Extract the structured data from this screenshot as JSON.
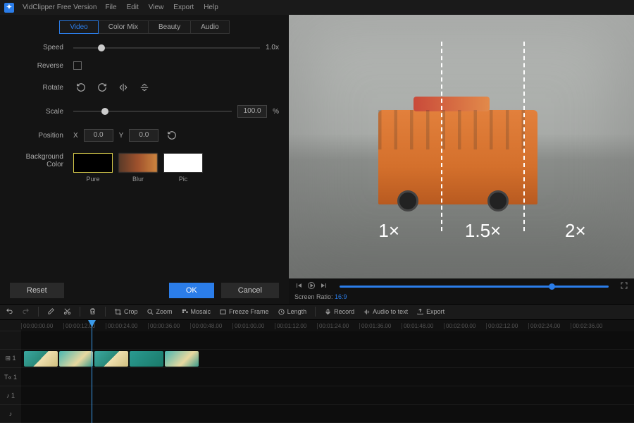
{
  "app": {
    "title": "VidClipper Free Version"
  },
  "menu": [
    "File",
    "Edit",
    "View",
    "Export",
    "Help"
  ],
  "tabs": [
    {
      "label": "Video",
      "active": true
    },
    {
      "label": "Color Mix",
      "active": false
    },
    {
      "label": "Beauty",
      "active": false
    },
    {
      "label": "Audio",
      "active": false
    }
  ],
  "form": {
    "speed": {
      "label": "Speed",
      "value": "1.0x",
      "pos": 15
    },
    "reverse": {
      "label": "Reverse",
      "checked": false
    },
    "rotate": {
      "label": "Rotate"
    },
    "scale": {
      "label": "Scale",
      "value": "100.0",
      "unit": "%",
      "pos": 20
    },
    "position": {
      "label": "Position",
      "x_label": "X",
      "x": "0.0",
      "y_label": "Y",
      "y": "0.0"
    },
    "bgcolor": {
      "label": "Background Color",
      "options": [
        {
          "name": "Pure",
          "selected": true
        },
        {
          "name": "Blur",
          "selected": false
        },
        {
          "name": "Pic",
          "selected": false
        }
      ]
    }
  },
  "buttons": {
    "reset": "Reset",
    "ok": "OK",
    "cancel": "Cancel"
  },
  "preview": {
    "zoom_labels": [
      "1×",
      "1.5×",
      "2×"
    ],
    "screen_ratio_label": "Screen Ratio:",
    "screen_ratio_value": "16:9"
  },
  "toolbar": {
    "crop": "Crop",
    "zoom": "Zoom",
    "mosaic": "Mosaic",
    "freeze": "Freeze Frame",
    "length": "Length",
    "record": "Record",
    "audio2text": "Audio to text",
    "export": "Export"
  },
  "timeline": {
    "marks": [
      "00:00:00.00",
      "00:00:12.00",
      "00:00:24.00",
      "00:00:36.00",
      "00:00:48.00",
      "00:01:00.00",
      "00:01:12.00",
      "00:01:24.00",
      "00:01:36.00",
      "00:01:48.00",
      "00:02:00.00",
      "00:02:12.00",
      "00:02:24.00",
      "00:02:36.00"
    ],
    "tracks": [
      "",
      "⊞ 1",
      "T« 1",
      "♪ 1",
      "♪"
    ]
  }
}
